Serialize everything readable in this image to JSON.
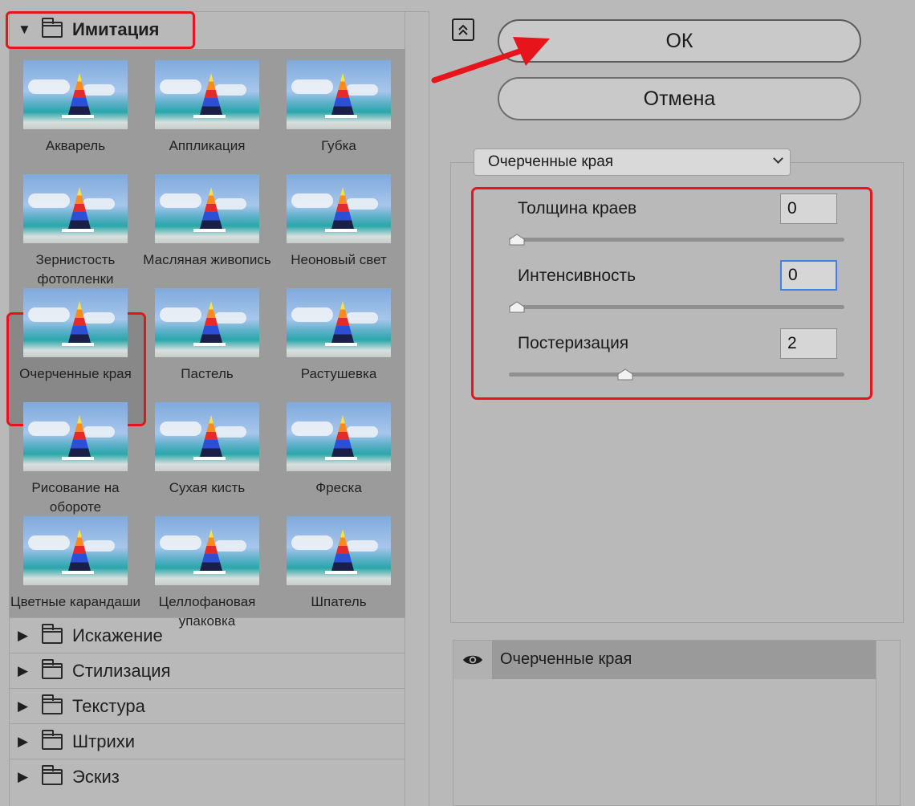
{
  "gallery": {
    "open_category": "Имитация",
    "thumbnails": [
      {
        "label": "Акварель"
      },
      {
        "label": "Аппликация"
      },
      {
        "label": "Губка"
      },
      {
        "label": "Зернистость фотопленки"
      },
      {
        "label": "Масляная живопись"
      },
      {
        "label": "Неоновый свет"
      },
      {
        "label": "Очерченные края",
        "selected": true
      },
      {
        "label": "Пастель"
      },
      {
        "label": "Растушевка"
      },
      {
        "label": "Рисование на обороте"
      },
      {
        "label": "Сухая кисть"
      },
      {
        "label": "Фреска"
      },
      {
        "label": "Цветные карандаши"
      },
      {
        "label": "Целлофановая упаковка"
      },
      {
        "label": "Шпатель"
      }
    ],
    "categories": [
      "Искажение",
      "Стилизация",
      "Текстура",
      "Штрихи",
      "Эскиз"
    ]
  },
  "buttons": {
    "ok": "ОК",
    "cancel": "Отмена"
  },
  "settings": {
    "filter_select": "Очерченные края",
    "params": [
      {
        "label": "Толщина краев",
        "value": "0",
        "slider_fraction": 0.0
      },
      {
        "label": "Интенсивность",
        "value": "0",
        "slider_fraction": 0.0
      },
      {
        "label": "Постеризация",
        "value": "2",
        "slider_fraction": 0.34
      }
    ]
  },
  "layers": {
    "items": [
      {
        "name": "Очерченные края"
      }
    ]
  },
  "colors": {
    "accent_red": "#e8141c",
    "focus_blue": "#3b86e4"
  },
  "icons": [
    "collapse-icon",
    "folder-icon",
    "eye-icon",
    "chevron-down-icon",
    "triangle-icon"
  ]
}
